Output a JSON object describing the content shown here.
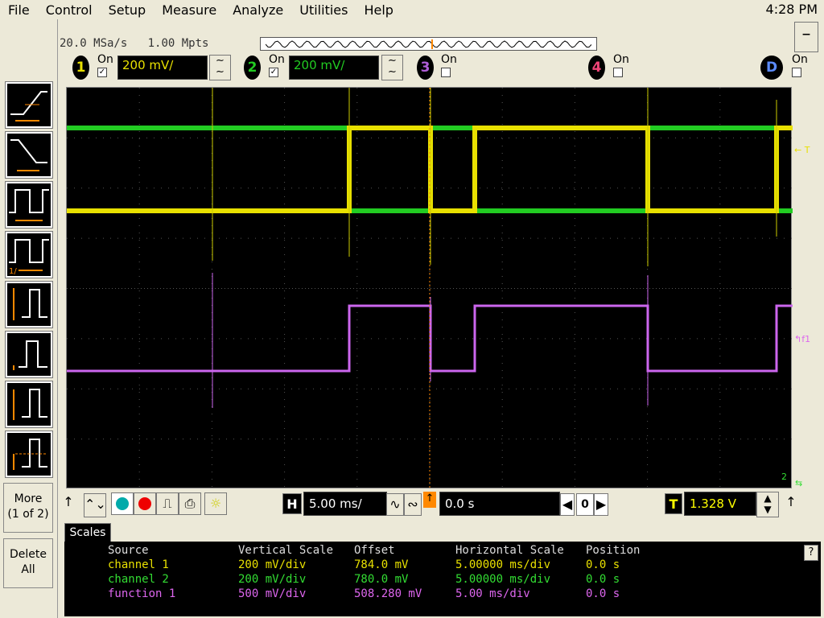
{
  "menu": [
    "File",
    "Control",
    "Setup",
    "Measure",
    "Analyze",
    "Utilities",
    "Help"
  ],
  "clock": "4:28 PM",
  "acq": {
    "rate": "20.0 MSa/s",
    "points": "1.00 Mpts"
  },
  "channels": [
    {
      "num": "1",
      "on_label": "On",
      "checked": true,
      "scale": "200 mV/",
      "color": "#e8e000"
    },
    {
      "num": "2",
      "on_label": "On",
      "checked": true,
      "scale": "200 mV/",
      "color": "#22cc22"
    },
    {
      "num": "3",
      "on_label": "On",
      "checked": false,
      "color": "#7b2fa6"
    },
    {
      "num": "4",
      "on_label": "On",
      "checked": false,
      "color": "#cc2255"
    },
    {
      "num": "D",
      "on_label": "On",
      "checked": false,
      "color": "#1a4fb0"
    }
  ],
  "side": {
    "more": "More",
    "more_sub": "(1 of 2)",
    "delete": "Delete",
    "delete_sub": "All"
  },
  "markers": {
    "trigger": "T",
    "f1": "f1",
    "two": "2"
  },
  "horizontal": {
    "label": "H",
    "scale": "5.00 ms/",
    "position": "0.0 s",
    "zero_label": "0"
  },
  "trigger": {
    "label": "T",
    "level": "1.328 V"
  },
  "tab": "Scales",
  "table": {
    "headers": [
      "Source",
      "Vertical Scale",
      "Offset",
      "Horizontal Scale",
      "Position"
    ],
    "rows": [
      {
        "source": "channel 1",
        "vscale": "200 mV/div",
        "offset": "784.0 mV",
        "hscale": "5.00000 ms/div",
        "pos": "0.0 s",
        "color": "#e8e000"
      },
      {
        "source": "channel 2",
        "vscale": "200 mV/div",
        "offset": "780.0 mV",
        "hscale": "5.00000 ms/div",
        "pos": "0.0 s",
        "color": "#33dd33"
      },
      {
        "source": "function 1",
        "vscale": "500 mV/div",
        "offset": "508.280 mV",
        "hscale": "5.00 ms/div",
        "pos": "0.0 s",
        "color": "#dd66ee"
      }
    ]
  },
  "help": "?"
}
